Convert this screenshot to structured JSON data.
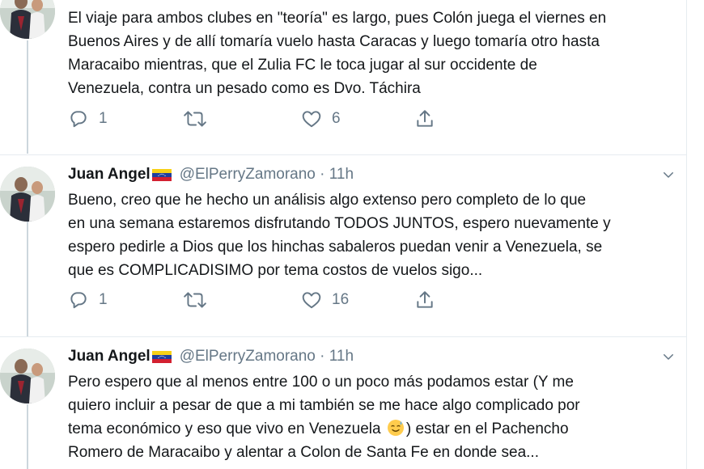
{
  "tweets": [
    {
      "lines": [
        "El viaje para ambos clubes en \"teoría\" es largo, pues Colón juega el viernes en",
        "Buenos Aires y de allí tomaría vuelo hasta Caracas y luego tomaría otro hasta",
        "Maracaibo mientras, que el Zulia FC le toca jugar al sur occidente de",
        "Venezuela, contra un pesado como es Dvo. Táchira"
      ],
      "replies": "1",
      "retweets": "",
      "likes": "6"
    },
    {
      "author": "Juan Angel",
      "handle": "@ElPerryZamorano · 11h",
      "lines": [
        "Bueno, creo que he hecho un análisis algo extenso pero completo de lo que",
        "en una semana estaremos disfrutando TODOS JUNTOS, espero nuevamente y",
        "espero pedirle a Dios que los hinchas sabaleros puedan venir a Venezuela, se",
        "que es COMPLICADISIMO por tema costos de vuelos sigo..."
      ],
      "replies": "1",
      "retweets": "",
      "likes": "16"
    },
    {
      "author": "Juan Angel",
      "handle": "@ElPerryZamorano · 11h",
      "lines": [
        "Pero espero que al menos entre 100 o un poco más podamos estar (Y me",
        "quiero incluir a pesar de que a mi también se me hace algo complicado por",
        "tema económico y eso que vivo en Venezuela",
        ") estar en el Pachencho",
        "Romero de Maracaibo y alentar a Colon de Santa Fe en donde sea..."
      ]
    }
  ],
  "colors": {
    "text": "#14171a",
    "secondary": "#657786",
    "divider": "#e6ecf0",
    "thread_line": "#ccd6dd"
  },
  "icons": [
    "reply-icon",
    "retweet-icon",
    "like-icon",
    "share-icon",
    "chevron-down-icon",
    "venezuela-flag-icon",
    "sweat-smile-emoji"
  ]
}
